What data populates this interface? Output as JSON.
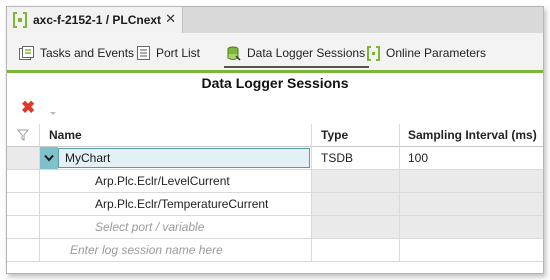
{
  "document_tab": {
    "title": "axc-f-2152-1 / PLCnext",
    "close_glyph": "✕",
    "icon": "plcnext-icon"
  },
  "sub_tabs": [
    {
      "label": "Tasks and Events",
      "icon": "tasks-icon"
    },
    {
      "label": "Port List",
      "icon": "list-icon"
    },
    {
      "label": "Data Logger Sessions",
      "icon": "datalogger-icon",
      "active": true
    },
    {
      "label": "Online Parameters",
      "icon": "plcnext-icon"
    }
  ],
  "page_title": "Data Logger Sessions",
  "toolbar": {
    "delete_glyph": "✖"
  },
  "grid": {
    "columns": [
      "Name",
      "Type",
      "Sampling Interval (ms)"
    ],
    "session": {
      "name": "MyChart",
      "type": "TSDB",
      "sampling_interval": "100"
    },
    "variables": [
      "Arp.Plc.Eclr/LevelCurrent",
      "Arp.Plc.Eclr/TemperatureCurrent"
    ],
    "select_variable_placeholder": "Select port / variable",
    "new_session_placeholder": "Enter log session name here"
  },
  "colors": {
    "accent_green": "#7fb43b",
    "selection_teal": "#7fc1ca",
    "delete_red": "#e0392b"
  }
}
